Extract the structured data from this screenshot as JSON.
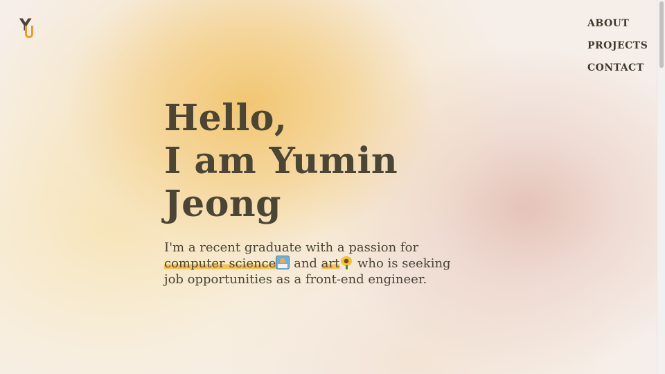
{
  "logo": {
    "letters": "YU",
    "accent_color": "#e0a030"
  },
  "nav": {
    "items": [
      {
        "label": "ABOUT"
      },
      {
        "label": "PROJECTS"
      },
      {
        "label": "CONTACT"
      }
    ]
  },
  "hero": {
    "line1": "Hello,",
    "line2": "I am Yumin",
    "line3": "Jeong"
  },
  "intro": {
    "part1": "I'm a recent graduate with a passion for ",
    "highlight1": "computer science",
    "emoji1": "technologist-emoji",
    "part2": " and ",
    "highlight2": "art",
    "emoji2": "sunflower-emoji",
    "part3": " who is seeking job opportunities as a front-end engineer."
  },
  "colors": {
    "text": "#4a4535",
    "highlight": "#f5be46",
    "background_warm": "#f1c46c",
    "background_pink": "#e2bcb0"
  }
}
